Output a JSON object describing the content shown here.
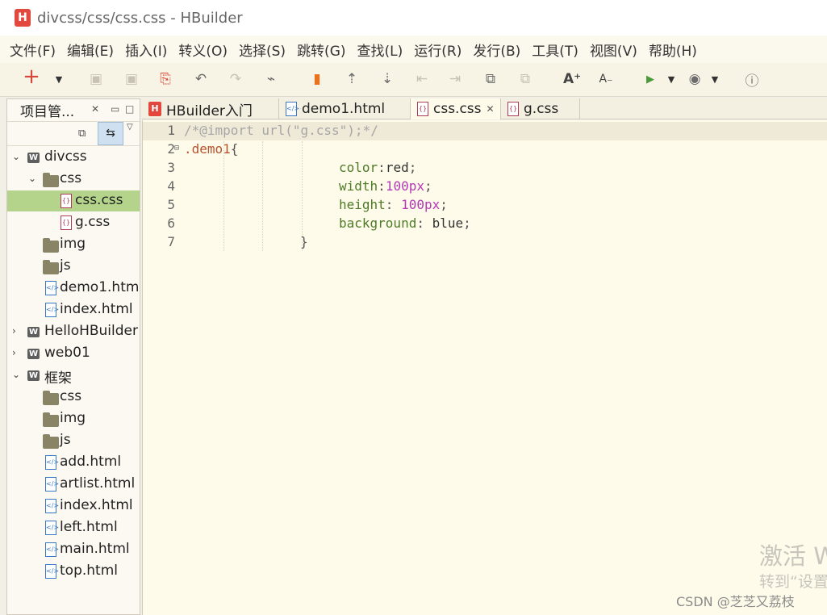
{
  "window": {
    "title": "divcss/css/css.css  -  HBuilder",
    "app_icon_letter": "H"
  },
  "menu": [
    "文件(F)",
    "编辑(E)",
    "插入(I)",
    "转义(O)",
    "选择(S)",
    "跳转(G)",
    "查找(L)",
    "运行(R)",
    "发行(B)",
    "工具(T)",
    "视图(V)",
    "帮助(H)"
  ],
  "toolbar": {
    "icons": [
      "add-icon",
      "dropdown-caret-icon",
      "save-icon",
      "save-all-icon",
      "save-as-icon",
      "undo-icon",
      "redo-icon",
      "format-icon",
      "bookmark-icon",
      "move-up-icon",
      "move-down-icon",
      "collapse-icon",
      "expand-icon",
      "copy-line-icon",
      "paste-line-icon",
      "font-increase-icon",
      "font-decrease-icon",
      "run-icon",
      "dropdown-caret-icon",
      "browser-icon",
      "dropdown-caret-icon",
      "info-icon"
    ]
  },
  "project_panel": {
    "title": "项目管...",
    "tree": [
      {
        "label": "divcss",
        "type": "project",
        "expanded": true,
        "level": 0
      },
      {
        "label": "css",
        "type": "folder",
        "expanded": true,
        "level": 1
      },
      {
        "label": "css.css",
        "type": "css",
        "level": 2,
        "selected": true
      },
      {
        "label": "g.css",
        "type": "css",
        "level": 2
      },
      {
        "label": "img",
        "type": "folder",
        "level": 1
      },
      {
        "label": "js",
        "type": "folder",
        "level": 1
      },
      {
        "label": "demo1.htm",
        "type": "html",
        "level": 1
      },
      {
        "label": "index.html",
        "type": "html",
        "level": 1
      },
      {
        "label": "HelloHBuilder",
        "type": "project",
        "expanded": false,
        "level": 0
      },
      {
        "label": "web01",
        "type": "project",
        "expanded": false,
        "level": 0
      },
      {
        "label": "框架",
        "type": "project",
        "expanded": true,
        "level": 0
      },
      {
        "label": "css",
        "type": "folder",
        "level": 1
      },
      {
        "label": "img",
        "type": "folder",
        "level": 1
      },
      {
        "label": "js",
        "type": "folder",
        "level": 1
      },
      {
        "label": "add.html",
        "type": "html",
        "level": 1
      },
      {
        "label": "artlist.html",
        "type": "html",
        "level": 1
      },
      {
        "label": "index.html",
        "type": "html",
        "level": 1
      },
      {
        "label": "left.html",
        "type": "html",
        "level": 1
      },
      {
        "label": "main.html",
        "type": "html",
        "level": 1
      },
      {
        "label": "top.html",
        "type": "html",
        "level": 1
      }
    ]
  },
  "tabs": [
    {
      "label": "HBuilder入门",
      "icon": "hbuilder-icon"
    },
    {
      "label": "demo1.html",
      "icon": "html-file-icon"
    },
    {
      "label": "css.css",
      "icon": "css-file-icon",
      "active": true
    },
    {
      "label": "g.css",
      "icon": "css-file-icon"
    }
  ],
  "editor": {
    "lines": [
      {
        "n": "1",
        "text": "/*@import url(\"g.css\");*/"
      },
      {
        "n": "2",
        "text": ".demo1{"
      },
      {
        "n": "3",
        "text": "color:red;"
      },
      {
        "n": "4",
        "text": "width:100px;"
      },
      {
        "n": "5",
        "text": "height: 100px;"
      },
      {
        "n": "6",
        "text": "background: blue;"
      },
      {
        "n": "7",
        "text": "}"
      }
    ]
  },
  "watermark": {
    "line1": "激活 W",
    "line2": "转到“设置",
    "credit": "CSDN @芝芝又荔枝"
  }
}
